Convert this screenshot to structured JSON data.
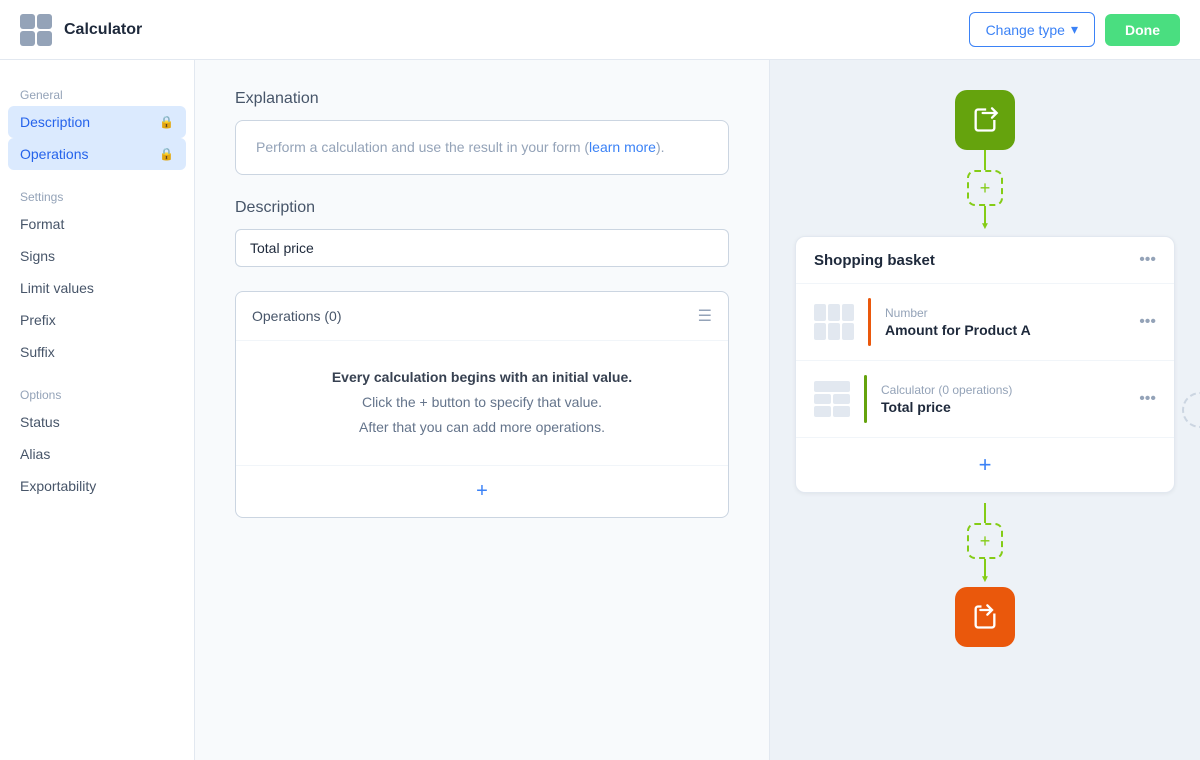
{
  "header": {
    "logo_alt": "Calculator logo",
    "title": "Calculator",
    "change_type_label": "Change type",
    "done_label": "Done"
  },
  "sidebar": {
    "general_label": "General",
    "settings_label": "Settings",
    "options_label": "Options",
    "items_general": [
      {
        "id": "description",
        "label": "Description",
        "locked": true,
        "active": true
      },
      {
        "id": "operations",
        "label": "Operations",
        "locked": true,
        "active": true
      }
    ],
    "items_settings": [
      {
        "id": "format",
        "label": "Format",
        "locked": false,
        "active": false
      },
      {
        "id": "signs",
        "label": "Signs",
        "locked": false,
        "active": false
      },
      {
        "id": "limit-values",
        "label": "Limit values",
        "locked": false,
        "active": false
      },
      {
        "id": "prefix",
        "label": "Prefix",
        "locked": false,
        "active": false
      },
      {
        "id": "suffix",
        "label": "Suffix",
        "locked": false,
        "active": false
      }
    ],
    "items_options": [
      {
        "id": "status",
        "label": "Status",
        "locked": false,
        "active": false
      },
      {
        "id": "alias",
        "label": "Alias",
        "locked": false,
        "active": false
      },
      {
        "id": "exportability",
        "label": "Exportability",
        "locked": false,
        "active": false
      }
    ]
  },
  "main": {
    "explanation_section": "Explanation",
    "explanation_text": "Perform a calculation and use the result in your form (",
    "explanation_link": "learn more",
    "explanation_suffix": ").",
    "description_section": "Description",
    "description_value": "Total price",
    "operations_header": "Operations (0)",
    "operations_empty_line1": "Every calculation begins with an initial value.",
    "operations_empty_line2": "Click the + button to specify that value.",
    "operations_empty_line3": "After that you can add more operations."
  },
  "right_panel": {
    "basket_title": "Shopping basket",
    "item1_type": "Number",
    "item1_name": "Amount for Product A",
    "item2_type": "Calculator (0 operations)",
    "item2_name": "Total price"
  },
  "colors": {
    "accent_blue": "#3b82f6",
    "accent_green": "#65a30d",
    "accent_orange": "#ea580c",
    "btn_done_bg": "#4ade80"
  }
}
